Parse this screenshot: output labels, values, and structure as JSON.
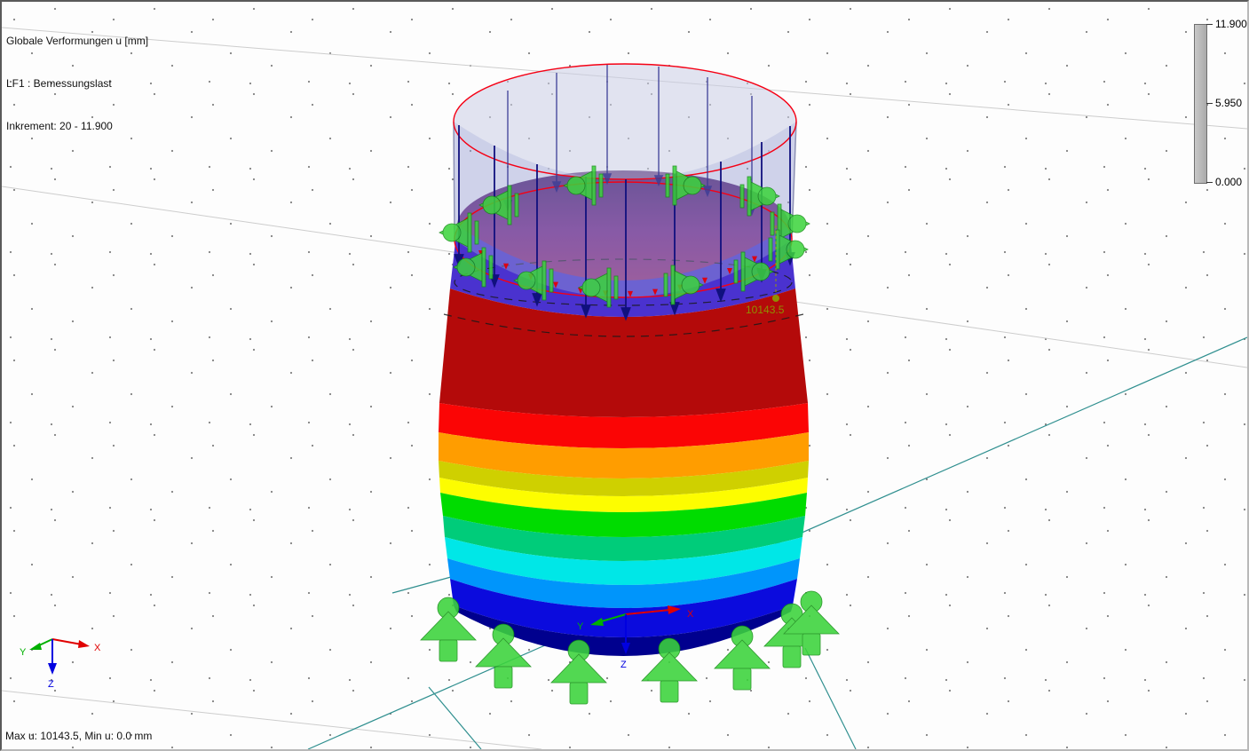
{
  "result_panel": {
    "title": "Globale Verformungen u [mm]",
    "loadcase": "LF1 : Bemessungslast",
    "increment": "Inkrement: 20 - 11.900"
  },
  "scale_bar": {
    "max": "11.900",
    "mid": "5.950",
    "min": "0.000"
  },
  "status_bar": {
    "text": "Max u: 10143.5, Min u: 0.0 mm"
  },
  "annotation": {
    "max_value": "10143.5"
  },
  "axes": {
    "global": {
      "x": "X",
      "y": "Y",
      "z": "Z"
    },
    "model": {
      "x": "X",
      "y": "Y",
      "z": "Z"
    }
  },
  "colors": {
    "band_scale_min_to_max": [
      "#00008e",
      "#0b0bdd",
      "#0095fb",
      "#00e7e7",
      "#00cc7a",
      "#00dc00",
      "#fdfd00",
      "#cfd000",
      "#ff9d00",
      "#fb0505",
      "#b40a0a",
      "#4a32cf"
    ],
    "shell_cap": "#7b2382",
    "supports_green": "#3bd43b",
    "load_outline_red": "#f50014",
    "load_fill_lavender": "#9aa3d4",
    "load_arrow_navy": "#10107e",
    "grid_line_gray": "#cdcdcd",
    "grid_axis_teal": "#2f8f8f",
    "annotation_olive": "#8f8f00",
    "axis_x_red": "#e00000",
    "axis_y_green": "#00b000",
    "axis_z_blue": "#0000e0"
  }
}
